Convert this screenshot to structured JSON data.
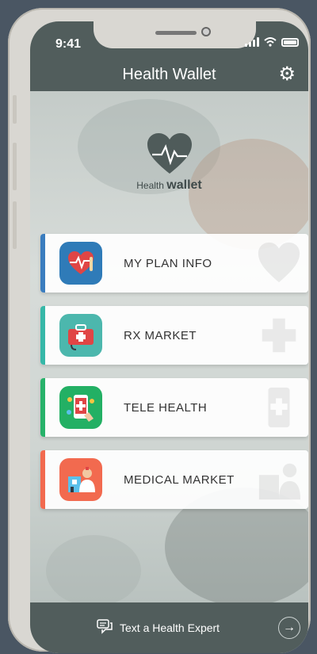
{
  "status": {
    "time": "9:41"
  },
  "header": {
    "title": "Health Wallet"
  },
  "logo": {
    "prefix": "Health",
    "suffix": "wallet"
  },
  "menu": [
    {
      "label": "MY PLAN INFO",
      "accent": "#3b7dbf",
      "icon_bg": "#2f7bb8",
      "icon": "heart-thermometer-icon"
    },
    {
      "label": "RX MARKET",
      "accent": "#36b8a8",
      "icon_bg": "#4cb7ad",
      "icon": "medical-bag-icon"
    },
    {
      "label": "TELE HEALTH",
      "accent": "#27b26a",
      "icon_bg": "#23b064",
      "icon": "phone-doctor-icon"
    },
    {
      "label": "MEDICAL MARKET",
      "accent": "#f26a4f",
      "icon_bg": "#f26a4f",
      "icon": "hospital-doctor-icon"
    }
  ],
  "footer": {
    "label": "Text a Health Expert"
  },
  "colors": {
    "bar": "#515d5c"
  }
}
